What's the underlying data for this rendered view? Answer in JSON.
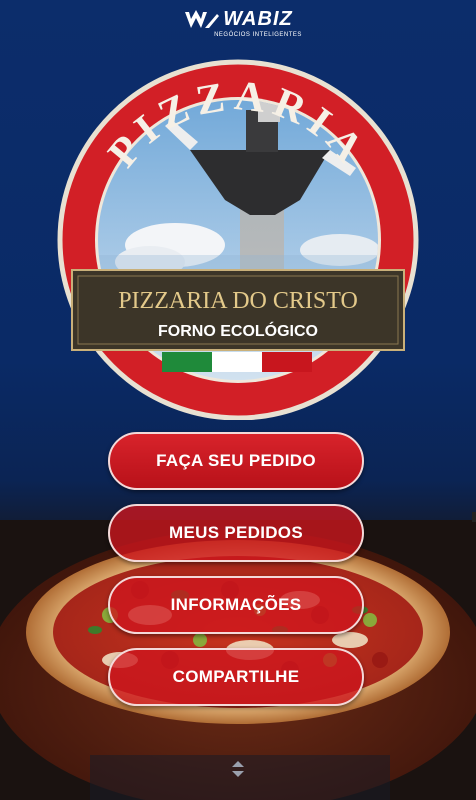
{
  "brand": {
    "name": "WABIZ",
    "tagline": "NEGÓCIOS INTELIGENTES"
  },
  "logo": {
    "arch_text": "PIZZARIA",
    "name": "PIZZARIA DO CRISTO",
    "subtitle": "FORNO ECOLÓGICO"
  },
  "menu": {
    "items": [
      {
        "label": "FAÇA SEU PEDIDO"
      },
      {
        "label": "MEUS PEDIDOS"
      },
      {
        "label": "INFORMAÇÕES"
      },
      {
        "label": "COMPARTILHE"
      }
    ]
  },
  "colors": {
    "background": "#0a2a66",
    "button_red": "#c8161e",
    "logo_red": "#d21f26",
    "plaque": "#3c3528",
    "plaque_text": "#e3c98a"
  },
  "icons": {
    "expand": "expand-handle-icon",
    "brand": "wabiz-logo-icon"
  }
}
